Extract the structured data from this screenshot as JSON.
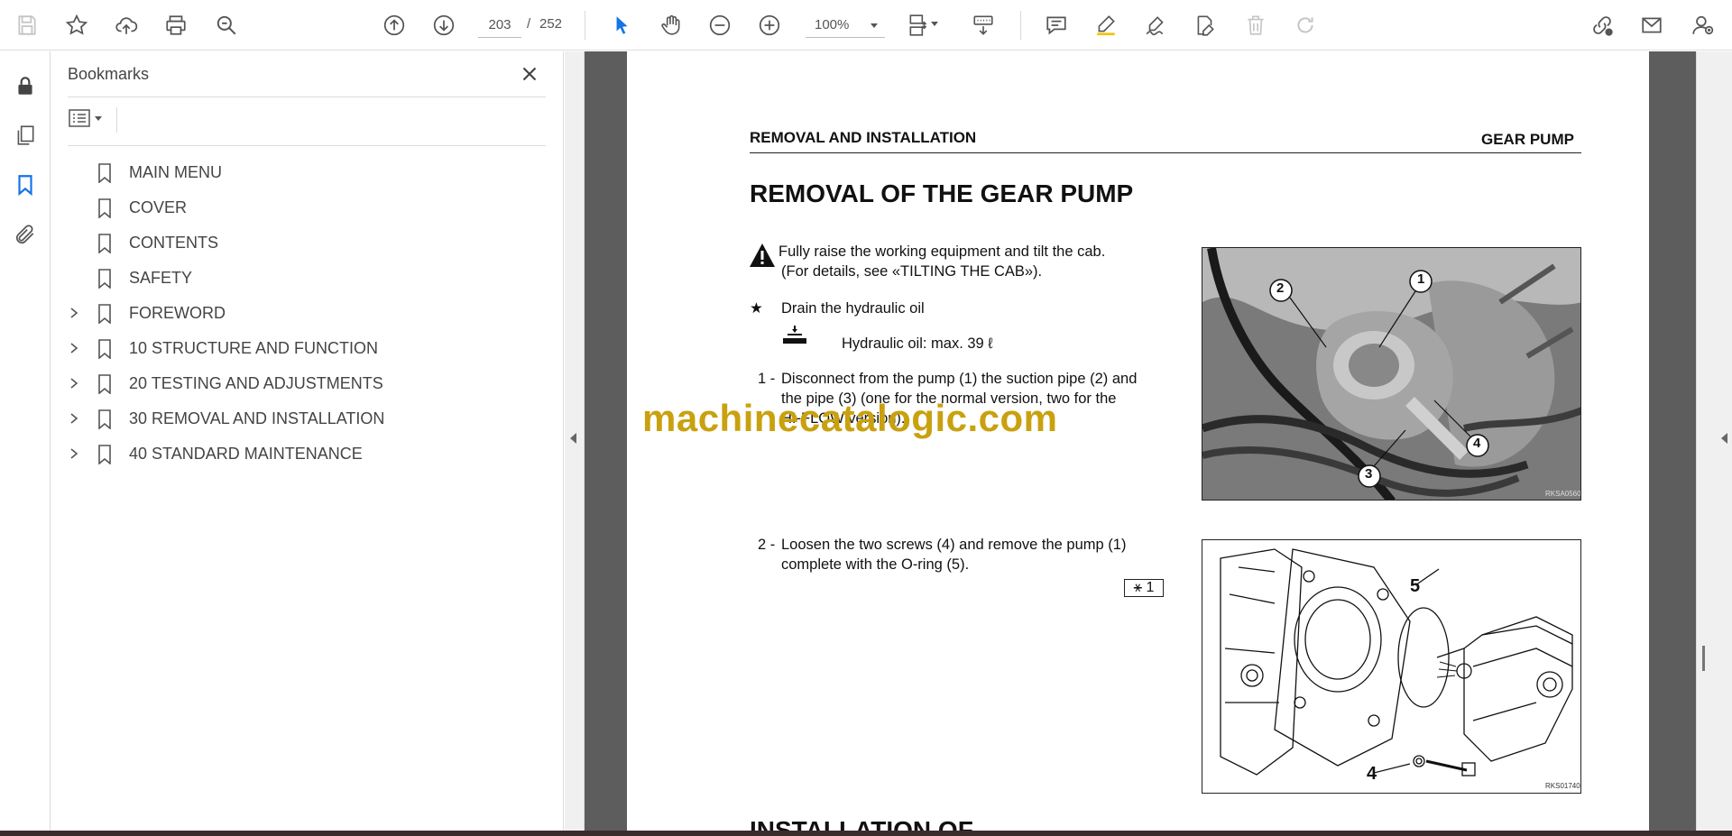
{
  "toolbar": {
    "current_page": "203",
    "page_separator": "/",
    "total_pages": "252",
    "zoom": "100%"
  },
  "bookmarks_panel": {
    "title": "Bookmarks",
    "items": [
      {
        "label": "MAIN MENU",
        "expandable": false
      },
      {
        "label": "COVER",
        "expandable": false
      },
      {
        "label": "CONTENTS",
        "expandable": false
      },
      {
        "label": "SAFETY",
        "expandable": false
      },
      {
        "label": "FOREWORD",
        "expandable": true
      },
      {
        "label": "10 STRUCTURE AND FUNCTION",
        "expandable": true
      },
      {
        "label": "20 TESTING AND ADJUSTMENTS",
        "expandable": true
      },
      {
        "label": "30 REMOVAL AND INSTALLATION",
        "expandable": true
      },
      {
        "label": "40 STANDARD MAINTENANCE",
        "expandable": true
      }
    ]
  },
  "document": {
    "header_left": "REMOVAL AND INSTALLATION",
    "header_right": "GEAR PUMP",
    "title": "REMOVAL OF THE GEAR PUMP",
    "warning_line1": "Fully raise the working equipment and tilt the cab.",
    "warning_line2": "(For details, see «TILTING THE CAB»).",
    "star_symbol": "★",
    "drain_text": "Drain the hydraulic oil",
    "oil_text": "Hydraulic oil: max. 39 ℓ",
    "step1_num": "1 -",
    "step1_line1": "Disconnect from the pump (1) the suction pipe (2) and",
    "step1_line2": "the pipe (3) (one for the normal version, two for the",
    "step1_line3": "HI-FLOW version).",
    "step2_num": "2 -",
    "step2_line1": "Loosen the two screws (4) and remove the pump (1)",
    "step2_line2": "complete with the O-ring (5).",
    "ref_badge": "⚹ 1",
    "next_heading": "INSTALLATION OF",
    "photo_callouts": [
      "1",
      "2",
      "3",
      "4"
    ],
    "photo_code": "RKSA0560",
    "drawing_callouts": [
      "5",
      "4"
    ],
    "drawing_code": "RKS01740"
  },
  "watermark": "machinecatalogic.com",
  "colors": {
    "watermark": "#c9a10f",
    "accent": "#1473e6",
    "doc_background": "#5d5d5d"
  }
}
